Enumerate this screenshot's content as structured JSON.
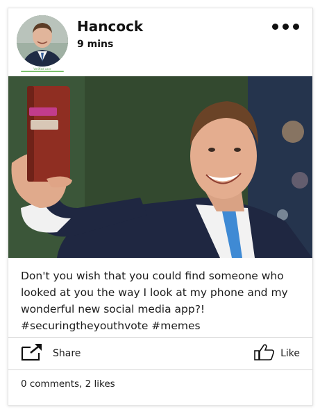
{
  "post": {
    "author": "Hancock",
    "time": "9 mins",
    "verified_label": "Verified user",
    "caption": "Don't you wish that you could find someone who looked at you the way I look at my phone and my wonderful new social media app?!",
    "hashtags": "#securingtheyouthvote #memes",
    "comments_count": 0,
    "likes_count": 2
  },
  "actions": {
    "share_label": "Share",
    "like_label": "Like"
  },
  "stats": {
    "text": "0 comments, 2 likes"
  },
  "icons": {
    "more": "more-options-icon",
    "share": "share-icon",
    "like": "thumbs-up-icon"
  },
  "colors": {
    "verified": "#58a14f",
    "photo_background": "#344b31"
  }
}
